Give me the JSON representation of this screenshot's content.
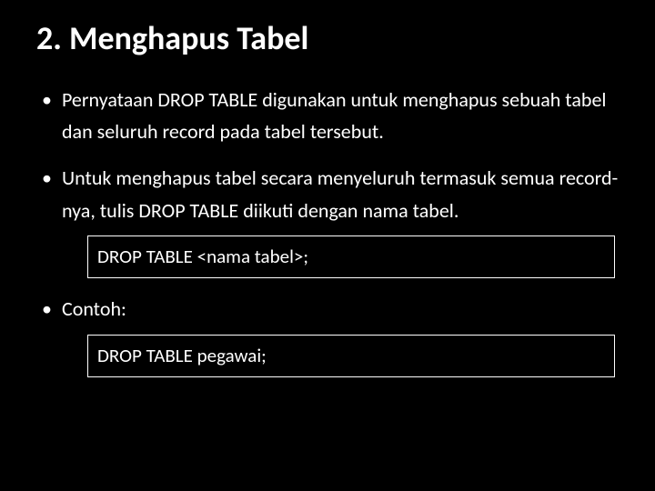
{
  "title": "2. Menghapus Tabel",
  "bullets": {
    "b1": "Pernyataan DROP TABLE digunakan untuk menghapus sebuah tabel dan seluruh record pada tabel tersebut.",
    "b2": "Untuk menghapus tabel secara menyeluruh termasuk semua record-nya, tulis DROP TABLE diikuti dengan nama tabel.",
    "code1": "DROP TABLE <nama tabel>;",
    "b3": "Contoh:",
    "code2": "DROP TABLE pegawai;"
  }
}
